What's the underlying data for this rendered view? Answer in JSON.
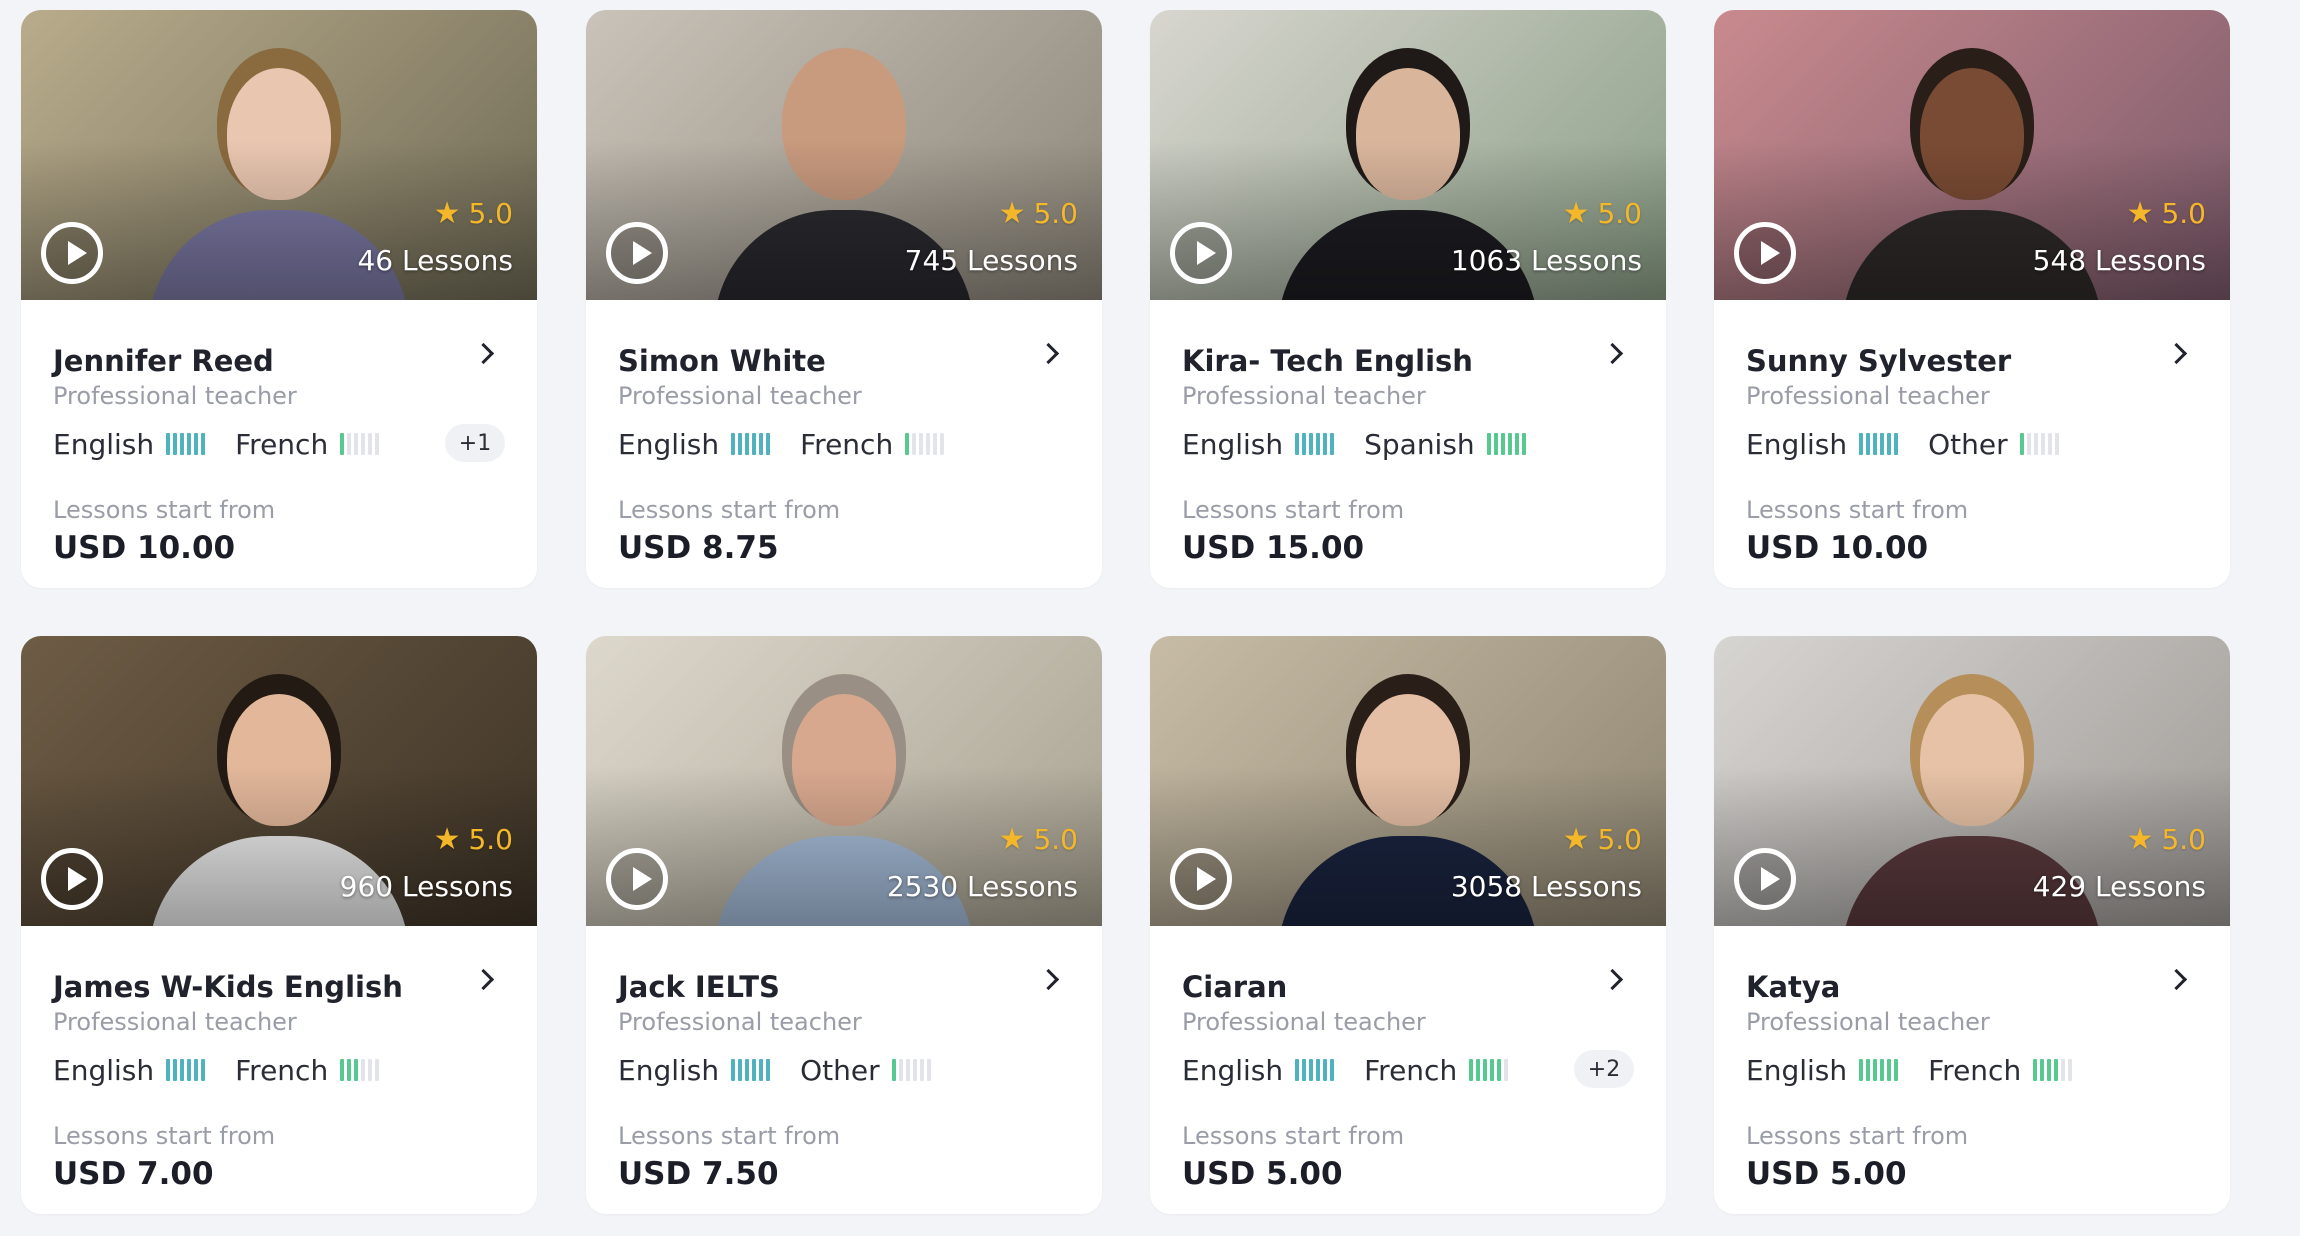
{
  "colors": {
    "star": "#f5b72a",
    "bar_teal": "#4fb3bf",
    "bar_green": "#55c98f",
    "bar_empty": "#e2e4ea"
  },
  "cards": [
    {
      "rating": "5.0",
      "lessons": "46 Lessons",
      "name": "Jennifer Reed",
      "role": "Professional teacher",
      "langs": [
        {
          "name": "English",
          "level": 6,
          "color": "#4fb3bf"
        },
        {
          "name": "French",
          "level": 1,
          "color": "#55c98f"
        }
      ],
      "more": "+1",
      "from_label": "Lessons start from",
      "price": "USD 10.00",
      "bg": [
        "#b9ac8c",
        "#6f6a55"
      ],
      "skin": "#e9c6b0",
      "hair": "#8a6a3f",
      "shirt": "#7d7aa6"
    },
    {
      "rating": "5.0",
      "lessons": "745 Lessons",
      "name": "Simon White",
      "role": "Professional teacher",
      "langs": [
        {
          "name": "English",
          "level": 6,
          "color": "#4fb3bf"
        },
        {
          "name": "French",
          "level": 1,
          "color": "#55c98f"
        }
      ],
      "more": "",
      "from_label": "Lessons start from",
      "price": "USD 8.75",
      "bg": [
        "#c9c3b9",
        "#8c8579"
      ],
      "skin": "#c89a7e",
      "hair": "#c89a7e",
      "shirt": "#2a2a30"
    },
    {
      "rating": "5.0",
      "lessons": "1063 Lessons",
      "name": "Kira- Tech English",
      "role": "Professional teacher",
      "langs": [
        {
          "name": "English",
          "level": 6,
          "color": "#4fb3bf"
        },
        {
          "name": "Spanish",
          "level": 6,
          "color": "#55c98f"
        }
      ],
      "more": "",
      "from_label": "Lessons start from",
      "price": "USD 15.00",
      "bg": [
        "#d8d6cf",
        "#8a9e86"
      ],
      "skin": "#d9b59c",
      "hair": "#1f1a17",
      "shirt": "#1d1d22"
    },
    {
      "rating": "5.0",
      "lessons": "548 Lessons",
      "name": "Sunny Sylvester",
      "role": "Professional teacher",
      "langs": [
        {
          "name": "English",
          "level": 6,
          "color": "#4fb3bf"
        },
        {
          "name": "Other",
          "level": 1,
          "color": "#55c98f"
        }
      ],
      "more": "",
      "from_label": "Lessons start from",
      "price": "USD 10.00",
      "bg": [
        "#c98a8e",
        "#7b5a6b"
      ],
      "skin": "#7a4b34",
      "hair": "#2a1e18",
      "shirt": "#2f2a2a"
    },
    {
      "rating": "5.0",
      "lessons": "960 Lessons",
      "name": "James W-Kids English",
      "role": "Professional teacher",
      "langs": [
        {
          "name": "English",
          "level": 6,
          "color": "#4fb3bf"
        },
        {
          "name": "French",
          "level": 3,
          "color": "#55c98f"
        }
      ],
      "more": "",
      "from_label": "Lessons start from",
      "price": "USD 7.00",
      "bg": [
        "#6e5c45",
        "#3d3326"
      ],
      "skin": "#e2b79a",
      "hair": "#231a14",
      "shirt": "#efefef"
    },
    {
      "rating": "5.0",
      "lessons": "2530 Lessons",
      "name": "Jack IELTS",
      "role": "Professional teacher",
      "langs": [
        {
          "name": "English",
          "level": 6,
          "color": "#4fb3bf"
        },
        {
          "name": "Other",
          "level": 1,
          "color": "#55c98f"
        }
      ],
      "more": "",
      "from_label": "Lessons start from",
      "price": "USD 7.50",
      "bg": [
        "#ddd8cc",
        "#a7a190"
      ],
      "skin": "#d8a88e",
      "hair": "#9a8f84",
      "shirt": "#a8bfdc"
    },
    {
      "rating": "5.0",
      "lessons": "3058 Lessons",
      "name": "Ciaran",
      "role": "Professional teacher",
      "langs": [
        {
          "name": "English",
          "level": 6,
          "color": "#4fb3bf"
        },
        {
          "name": "French",
          "level": 5,
          "color": "#55c98f"
        }
      ],
      "more": "+2",
      "from_label": "Lessons start from",
      "price": "USD 5.00",
      "bg": [
        "#c7bca6",
        "#8e8571"
      ],
      "skin": "#e5bfa5",
      "hair": "#2a1f18",
      "shirt": "#1a2440"
    },
    {
      "rating": "5.0",
      "lessons": "429 Lessons",
      "name": "Katya",
      "role": "Professional teacher",
      "langs": [
        {
          "name": "English",
          "level": 6,
          "color": "#55c98f"
        },
        {
          "name": "French",
          "level": 4,
          "color": "#55c98f"
        }
      ],
      "more": "",
      "from_label": "Lessons start from",
      "price": "USD 5.00",
      "bg": [
        "#d7d5d2",
        "#9e9a96"
      ],
      "skin": "#e7c2a6",
      "hair": "#b58e5a",
      "shirt": "#5b3a3d"
    }
  ]
}
